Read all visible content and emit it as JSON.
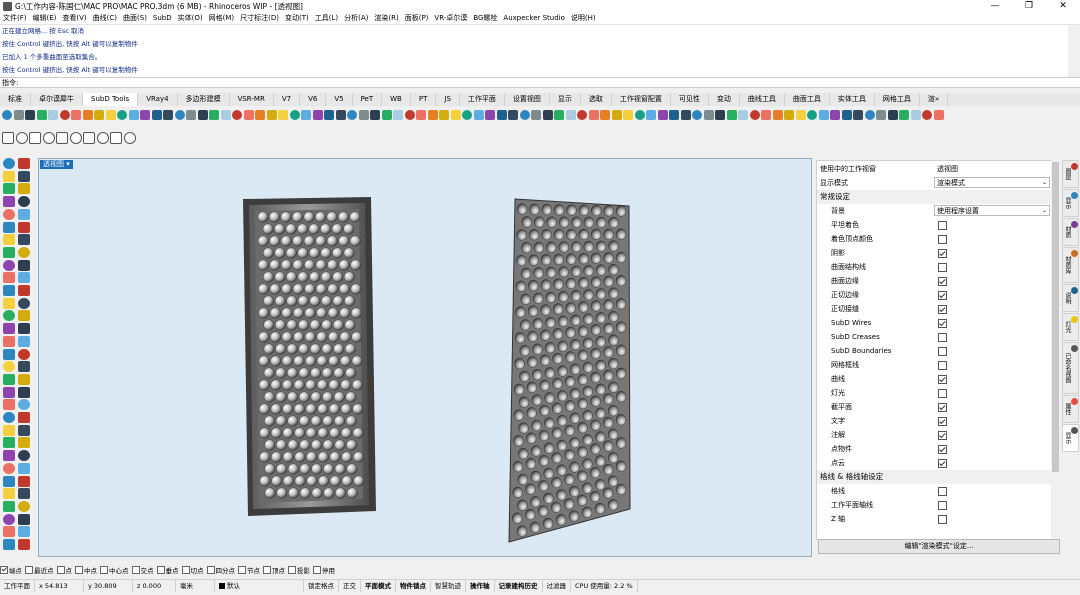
{
  "window": {
    "title": "G:\\工作内容-陈国仁\\MAC PRO\\MAC PRO.3dm (6 MB) - Rhinoceros WIP - [透视图]",
    "min_glyph": "—",
    "max_glyph": "❐",
    "close_glyph": "✕"
  },
  "menu": [
    "文件(F)",
    "编辑(E)",
    "查看(V)",
    "曲线(C)",
    "曲面(S)",
    "SubD",
    "实体(O)",
    "网格(M)",
    "尺寸标注(D)",
    "变动(T)",
    "工具(L)",
    "分析(A)",
    "渲染(R)",
    "面板(P)",
    "VR-卓尔谟",
    "BG螺栓",
    "Auxpecker Studio",
    "说明(H)"
  ],
  "history": [
    "正在建立网格... 按 Esc 取消",
    "按住 Control 键挤出, 快按 Alt 键可以复制物件",
    "已加入 1 个多重曲面至选取集合。",
    "按住 Control 键挤出, 快按 Alt 键可以复制物件"
  ],
  "command": {
    "prompt": "指令:"
  },
  "tabs": [
    "标准",
    "卓尔谟犀牛",
    "SubD Tools",
    "VRay4",
    "多边形建模",
    "VSR-MR",
    "V7",
    "V6",
    "V5",
    "PeT",
    "WB",
    "PT",
    "JS",
    "工作平面",
    "设置视图",
    "显示",
    "选取",
    "工作视窗配置",
    "可见性",
    "变动",
    "曲线工具",
    "曲面工具",
    "实体工具",
    "网格工具",
    "渲»"
  ],
  "active_tab": "SubD Tools",
  "viewport": {
    "label": "透视图",
    "bg_color": "#dbe9f5"
  },
  "properties": {
    "rows": [
      {
        "type": "row",
        "label": "使用中的工作视窗",
        "value": "透视图"
      },
      {
        "type": "dropdown",
        "label": "显示模式",
        "value": "渲染模式"
      },
      {
        "type": "section",
        "label": "常规设定"
      },
      {
        "type": "dropdown",
        "label": "背景",
        "value": "使用程序设置"
      },
      {
        "type": "check",
        "label": "平坦着色",
        "checked": false
      },
      {
        "type": "check",
        "label": "着色顶点颜色",
        "checked": false
      },
      {
        "type": "check",
        "label": "阴影",
        "checked": true
      },
      {
        "type": "check",
        "label": "曲面结构线",
        "checked": false
      },
      {
        "type": "check",
        "label": "曲面边缘",
        "checked": true
      },
      {
        "type": "check",
        "label": "正切边缘",
        "checked": true
      },
      {
        "type": "check",
        "label": "正切接缝",
        "checked": true
      },
      {
        "type": "check",
        "label": "SubD Wires",
        "checked": true
      },
      {
        "type": "check",
        "label": "SubD Creases",
        "checked": false
      },
      {
        "type": "check",
        "label": "SubD Boundaries",
        "checked": false
      },
      {
        "type": "check",
        "label": "网格框线",
        "checked": false
      },
      {
        "type": "check",
        "label": "曲线",
        "checked": true
      },
      {
        "type": "check",
        "label": "灯光",
        "checked": false
      },
      {
        "type": "check",
        "label": "截平面",
        "checked": true
      },
      {
        "type": "check",
        "label": "文字",
        "checked": true
      },
      {
        "type": "check",
        "label": "注解",
        "checked": true
      },
      {
        "type": "check",
        "label": "点物件",
        "checked": true
      },
      {
        "type": "check",
        "label": "点云",
        "checked": true
      },
      {
        "type": "section",
        "label": "格线 & 格线轴设定"
      },
      {
        "type": "check",
        "label": "格线",
        "checked": false
      },
      {
        "type": "check",
        "label": "工作平面轴线",
        "checked": false
      },
      {
        "type": "check",
        "label": "Z 轴",
        "checked": false
      }
    ],
    "edit_button": "编辑\"渲染模式\"设定..."
  },
  "right_tabs": [
    {
      "label": "图层",
      "icon_color": "#c0392b"
    },
    {
      "label": "显示",
      "icon_color": "#2e86c1"
    },
    {
      "label": "材质",
      "icon_color": "#7d3c98"
    },
    {
      "label": "材质库",
      "icon_color": "#ca6f1e"
    },
    {
      "label": "说明",
      "icon_color": "#1f618d"
    },
    {
      "label": "灯光",
      "icon_color": "#f1c40f"
    },
    {
      "label": "已命名视图",
      "icon_color": "#555555"
    },
    {
      "label": "属性",
      "icon_color": "#e74c3c"
    },
    {
      "label": "显示",
      "icon_color": "#555555"
    }
  ],
  "osnap": [
    {
      "label": "端点",
      "checked": true
    },
    {
      "label": "最近点",
      "checked": false
    },
    {
      "label": "点",
      "checked": false
    },
    {
      "label": "中点",
      "checked": false
    },
    {
      "label": "中心点",
      "checked": false
    },
    {
      "label": "交点",
      "checked": false
    },
    {
      "label": "垂点",
      "checked": false
    },
    {
      "label": "切点",
      "checked": false
    },
    {
      "label": "四分点",
      "checked": false
    },
    {
      "label": "节点",
      "checked": false
    },
    {
      "label": "顶点",
      "checked": false
    },
    {
      "label": "投影",
      "checked": false
    },
    {
      "label": "停用",
      "checked": false
    }
  ],
  "status": {
    "cplane": "工作平面",
    "x": "x 54.813",
    "y": "y 30.809",
    "z": "z 0.000",
    "unit": "毫米",
    "layer": "默认",
    "items": [
      {
        "label": "锁定格点",
        "bold": false
      },
      {
        "label": "正交",
        "bold": false
      },
      {
        "label": "平面模式",
        "bold": true
      },
      {
        "label": "物件锁点",
        "bold": true
      },
      {
        "label": "智慧轨迹",
        "bold": false
      },
      {
        "label": "操作轴",
        "bold": true
      },
      {
        "label": "记录建构历史",
        "bold": true
      },
      {
        "label": "过滤器",
        "bold": false
      },
      {
        "label": "CPU 使用量: 2.2 %",
        "bold": false
      }
    ]
  },
  "icon_palette": [
    "#2e86c1",
    "#1f618d",
    "#5dade2",
    "#f4d03f",
    "#e67e22",
    "#c0392b",
    "#27ae60",
    "#7f8c8d",
    "#34495e",
    "#8e44ad",
    "#16a085",
    "#d4ac0d",
    "#ec7063",
    "#a9cce3",
    "#2c3e50"
  ]
}
